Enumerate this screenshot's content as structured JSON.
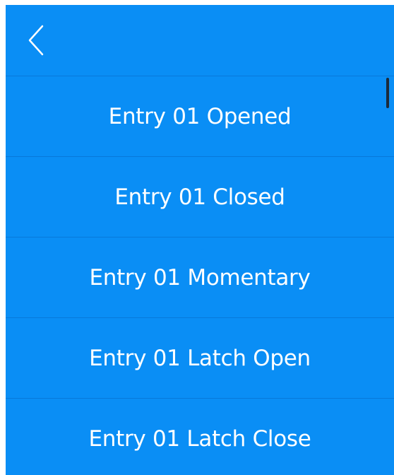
{
  "header": {
    "back_icon": "chevron-left-icon"
  },
  "menu": {
    "items": [
      {
        "label": "Entry 01 Opened"
      },
      {
        "label": "Entry 01 Closed"
      },
      {
        "label": "Entry 01 Momentary"
      },
      {
        "label": "Entry 01 Latch Open"
      },
      {
        "label": "Entry 01 Latch Close"
      }
    ]
  },
  "colors": {
    "background": "#0a8ef5",
    "text": "#ffffff",
    "divider": "#0a6fc4",
    "scrollbar": "#1b2a3a"
  }
}
